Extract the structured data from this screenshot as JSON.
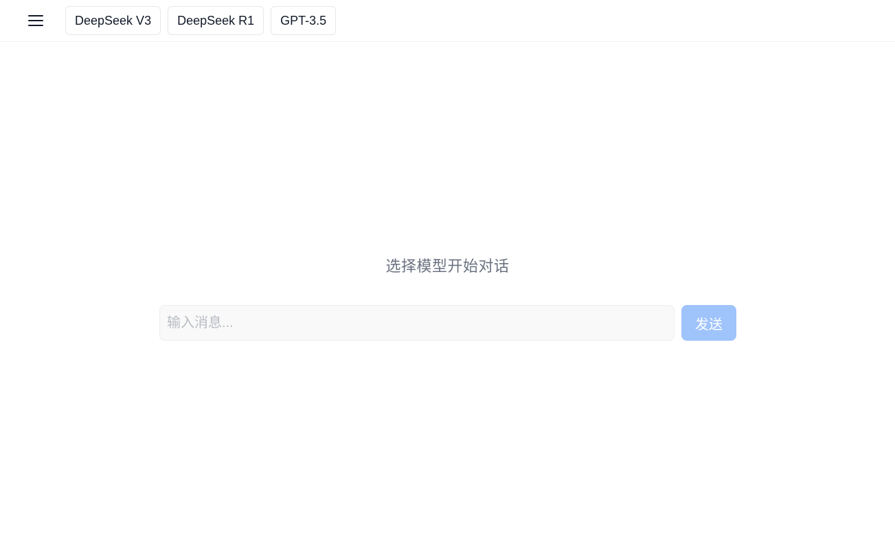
{
  "header": {
    "menu_icon": "hamburger-menu-icon",
    "model_tabs": [
      {
        "label": "DeepSeek V3"
      },
      {
        "label": "DeepSeek R1"
      },
      {
        "label": "GPT-3.5"
      }
    ]
  },
  "main": {
    "prompt_title": "选择模型开始对话",
    "input": {
      "value": "",
      "placeholder": "输入消息..."
    },
    "send_label": "发送"
  },
  "colors": {
    "send_button": "#9fc3fb",
    "prompt_text": "#6b7280",
    "input_background": "#f9f9f9"
  }
}
